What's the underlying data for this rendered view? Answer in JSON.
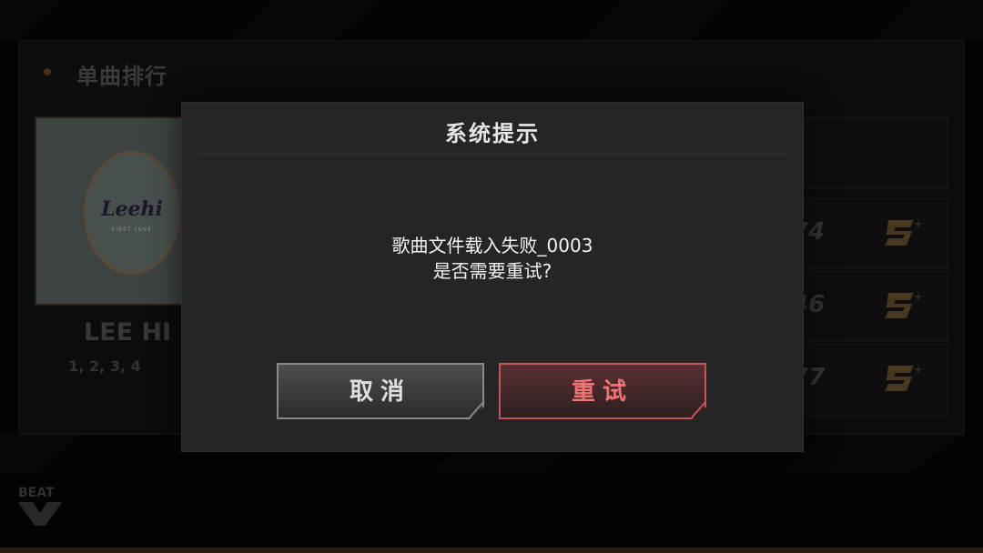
{
  "section": {
    "title": "单曲排行"
  },
  "album": {
    "logo_text": "Leehi",
    "logo_sub": "FIRST LOVE"
  },
  "song": {
    "artist": "LEE HI",
    "title": "1, 2, 3, 4"
  },
  "ranks": [
    {
      "score": "74",
      "badge": "S+"
    },
    {
      "score": "46",
      "badge": "S+"
    },
    {
      "score": "77",
      "badge": "S+"
    }
  ],
  "footer": {
    "logo_text": "BEAT"
  },
  "dialog": {
    "title": "系统提示",
    "message_line1": "歌曲文件载入失败_0003",
    "message_line2": "是否需要重试?",
    "cancel_label": "取消",
    "retry_label": "重试"
  },
  "colors": {
    "accent_retry": "#f07474",
    "dialog_bg": "#252525"
  }
}
